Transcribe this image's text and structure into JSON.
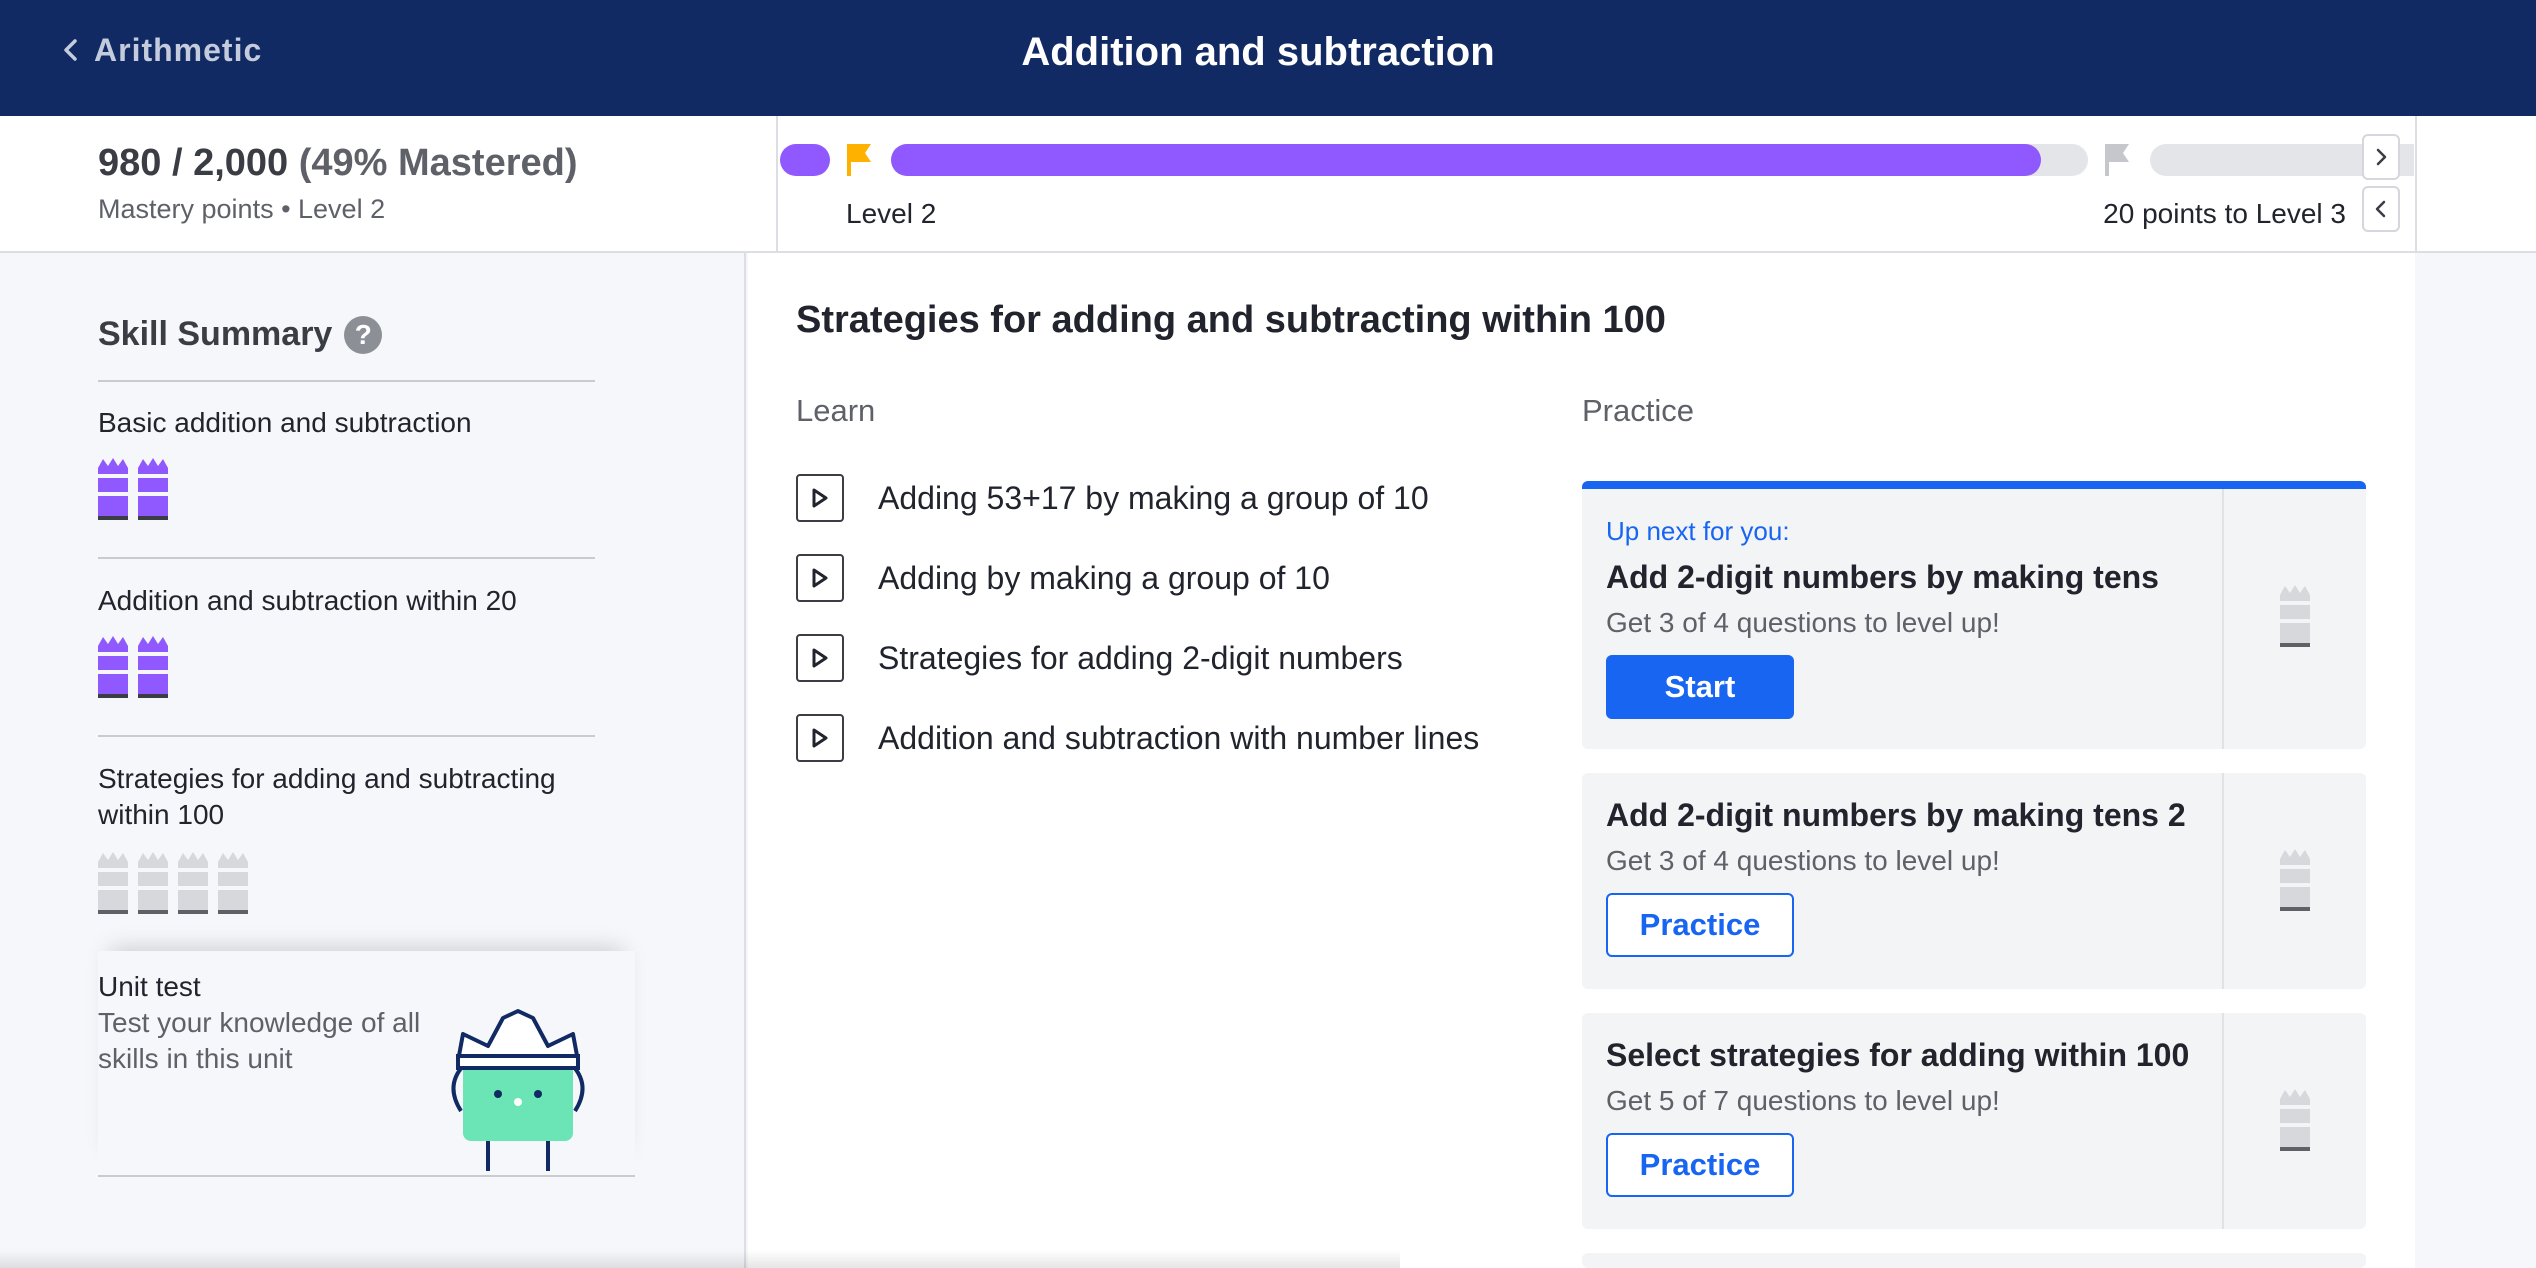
{
  "header": {
    "back_label": "Arithmetic",
    "title": "Addition and subtraction"
  },
  "mastery": {
    "points": "980 / 2,000",
    "percent": "(49% Mastered)",
    "subtitle": "Mastery points • Level 2",
    "progress_fraction": 0.49,
    "level_label": "Level 2",
    "to_next_label": "20 points to Level 3"
  },
  "sidebar": {
    "heading": "Skill Summary",
    "help_icon": "?",
    "skills": [
      {
        "title": "Basic addition and subtraction",
        "crowns_mastered": 2,
        "crowns_total": 2
      },
      {
        "title": "Addition and subtraction within 20",
        "crowns_mastered": 2,
        "crowns_total": 2
      },
      {
        "title": "Strategies for adding and subtracting within 100",
        "crowns_mastered": 0,
        "crowns_total": 4
      }
    ],
    "unit_test": {
      "title": "Unit test",
      "description": "Test your knowledge of all skills in this unit"
    }
  },
  "main": {
    "section_title": "Strategies for adding and subtracting within 100",
    "learn_label": "Learn",
    "practice_label": "Practice",
    "learn_items": [
      "Adding 53+17 by making a group of 10",
      "Adding by making a group of 10",
      "Strategies for adding 2-digit numbers",
      "Addition and subtraction with number lines"
    ],
    "practice_cards": [
      {
        "up_next": "Up next for you:",
        "title": "Add 2-digit numbers by making tens",
        "subtitle": "Get 3 of 4 questions to level up!",
        "button": "Start"
      },
      {
        "title": "Add 2-digit numbers by making tens 2",
        "subtitle": "Get 3 of 4 questions to level up!",
        "button": "Practice"
      },
      {
        "title": "Select strategies for adding within 100",
        "subtitle": "Get 5 of 7 questions to level up!",
        "button": "Practice"
      }
    ]
  },
  "colors": {
    "header_bg": "#112a63",
    "mastery_purple": "#9059ff",
    "accent_blue": "#1865f2",
    "flag_gold": "#ffb100",
    "mascot_green": "#6be5b5"
  }
}
